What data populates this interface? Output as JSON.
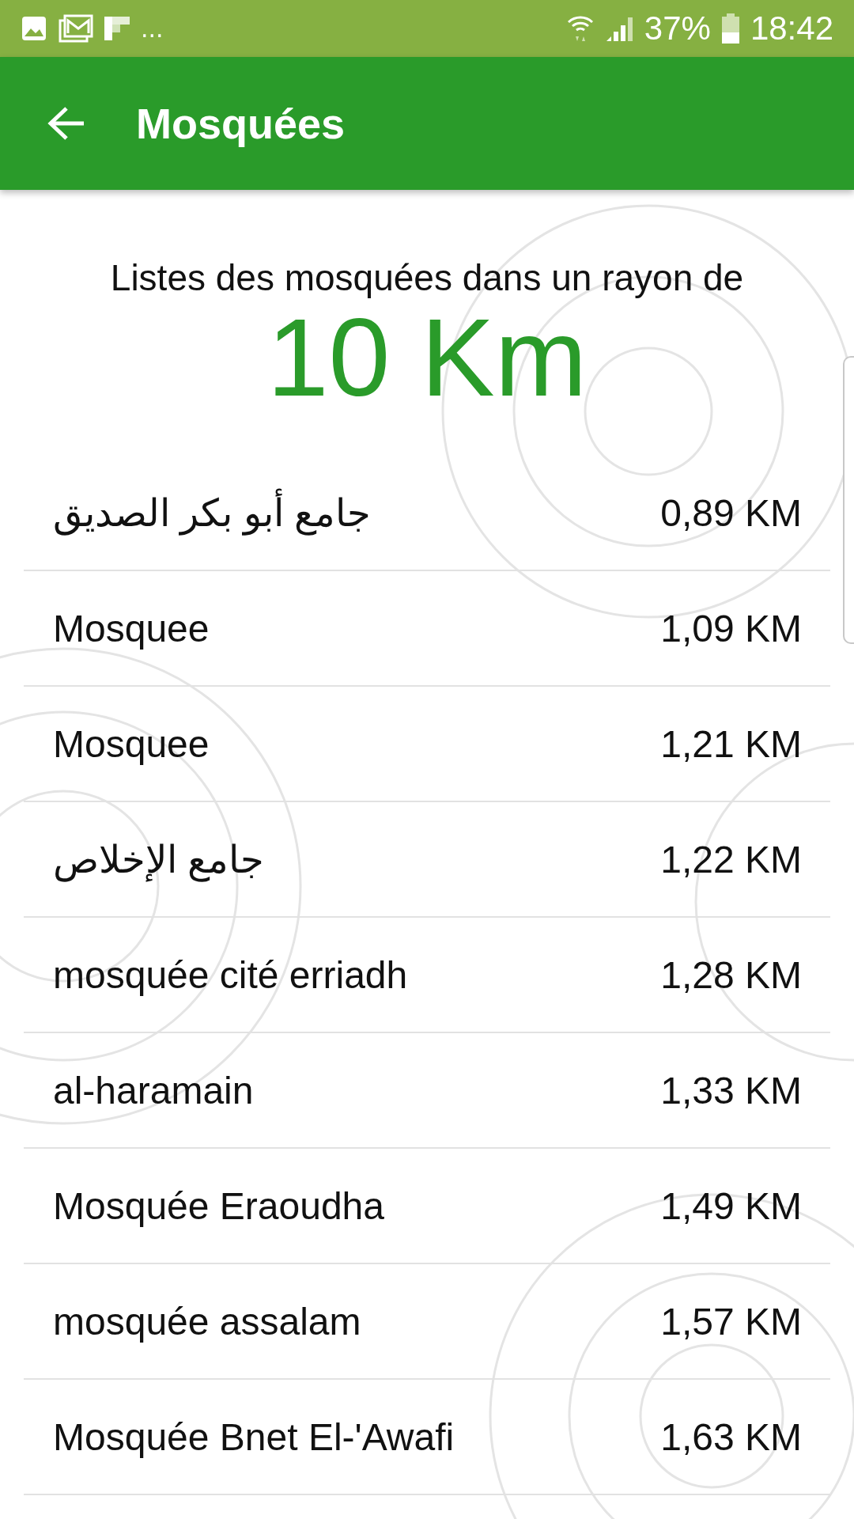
{
  "status_bar": {
    "notifications_more": "...",
    "battery": "37%",
    "time": "18:42"
  },
  "app_bar": {
    "title": "Mosquées"
  },
  "header": {
    "caption": "Listes des mosquées dans un rayon de",
    "radius": "10 Km"
  },
  "mosques": [
    {
      "name": "جامع أبو بكر الصديق",
      "distance": "0,89 KM"
    },
    {
      "name": "Mosquee",
      "distance": "1,09 KM"
    },
    {
      "name": "Mosquee",
      "distance": "1,21 KM"
    },
    {
      "name": "جامع الإخلاص",
      "distance": "1,22 KM"
    },
    {
      "name": "mosquée cité erriadh",
      "distance": "1,28 KM"
    },
    {
      "name": "al-haramain",
      "distance": "1,33 KM"
    },
    {
      "name": "Mosquée Eraoudha",
      "distance": "1,49 KM"
    },
    {
      "name": "mosquée assalam",
      "distance": "1,57 KM"
    },
    {
      "name": "Mosquée Bnet El-'Awafi",
      "distance": "1,63 KM"
    }
  ]
}
